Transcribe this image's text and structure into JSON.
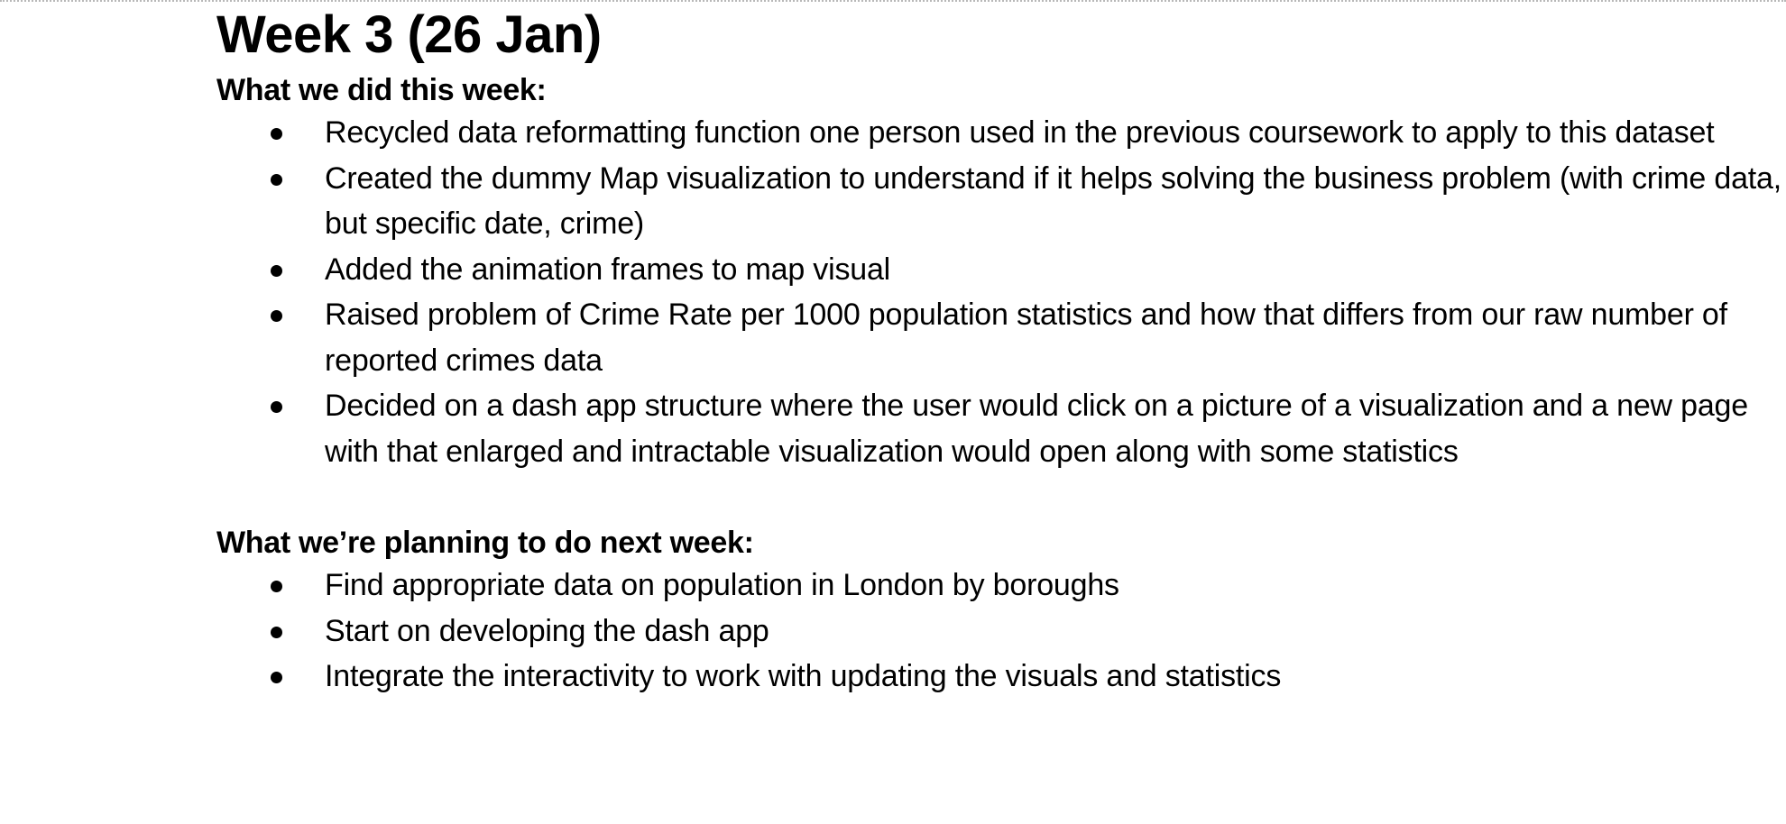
{
  "document": {
    "title": "Week 3 (26 Jan)",
    "sections": [
      {
        "heading": "What we did this week:",
        "items": [
          "Recycled data reformatting function one person used in the previous coursework to apply to this dataset",
          "Created the dummy Map visualization to understand if it helps solving the business problem (with crime data, but specific date, crime)",
          "Added the animation frames to map visual",
          "Raised problem of Crime Rate per 1000 population statistics and how that differs from our raw number of reported crimes data",
          "Decided on a dash app structure where the user would click on a picture of a visualization and a new page with that enlarged and intractable visualization would open along with some statistics"
        ]
      },
      {
        "heading": "What we’re planning to do next week:",
        "items": [
          "Find appropriate data on population in London by boroughs",
          "Start on developing the dash app",
          "Integrate the interactivity to work with updating the visuals and statistics"
        ]
      }
    ]
  }
}
